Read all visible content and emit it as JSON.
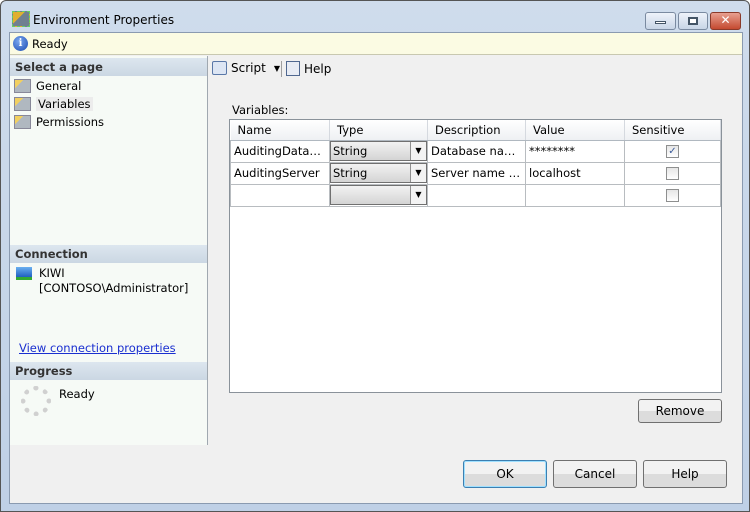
{
  "window": {
    "title": "Environment Properties",
    "icon": "environment-properties-icon"
  },
  "status": {
    "icon": "info-icon",
    "text": "Ready"
  },
  "sidebar": {
    "select_page_header": "Select a page",
    "pages": [
      {
        "label": "General"
      },
      {
        "label": "Variables"
      },
      {
        "label": "Permissions"
      }
    ],
    "connection_header": "Connection",
    "server": "KIWI",
    "user": "[CONTOSO\\Administrator]",
    "view_connection_link": "View connection properties",
    "progress_header": "Progress",
    "progress_status": "Ready"
  },
  "toolbar": {
    "script_label": "Script",
    "help_label": "Help"
  },
  "variables": {
    "label": "Variables:",
    "columns": [
      "Name",
      "Type",
      "Description",
      "Value",
      "Sensitive"
    ],
    "rows": [
      {
        "name": "AuditingDataba...",
        "type": "String",
        "description": "Database name...",
        "value": "********",
        "sensitive": true
      },
      {
        "name": "AuditingServer",
        "type": "String",
        "description": "Server name for...",
        "value": "localhost",
        "sensitive": false
      },
      {
        "name": "",
        "type": "",
        "description": "",
        "value": "",
        "sensitive": false
      }
    ],
    "remove_label": "Remove"
  },
  "footer": {
    "ok": "OK",
    "cancel": "Cancel",
    "help": "Help"
  }
}
